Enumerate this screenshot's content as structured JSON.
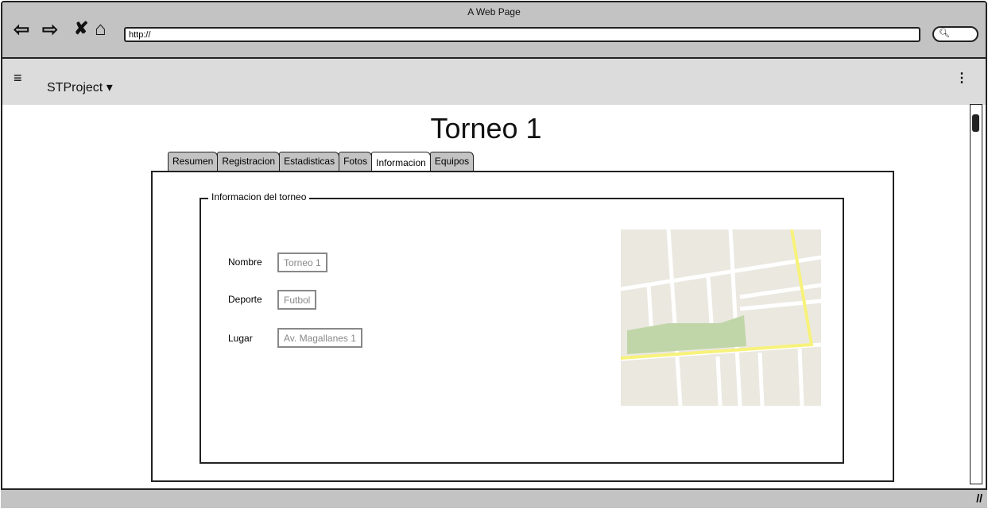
{
  "browser": {
    "title": "A Web Page",
    "url": "http://"
  },
  "appbar": {
    "project": "STProject",
    "dropdown_icon": "▾",
    "menu_icon": "≡",
    "more_icon": "⋮"
  },
  "page": {
    "title": "Torneo 1"
  },
  "tabs": [
    {
      "label": "Resumen"
    },
    {
      "label": "Registracion"
    },
    {
      "label": "Estadisticas"
    },
    {
      "label": "Fotos"
    },
    {
      "label": "Informacion",
      "active": true
    },
    {
      "label": "Equipos"
    }
  ],
  "info": {
    "legend": "Informacion del torneo",
    "fields": [
      {
        "label": "Nombre",
        "value": "Torneo 1"
      },
      {
        "label": "Deporte",
        "value": "Futbol"
      },
      {
        "label": "Lugar",
        "value": "Av. Magallanes 1"
      }
    ]
  },
  "colors": {
    "map_bg": "#ebe8e0",
    "park": "#c0d6a8",
    "road": "#f7f27a"
  }
}
